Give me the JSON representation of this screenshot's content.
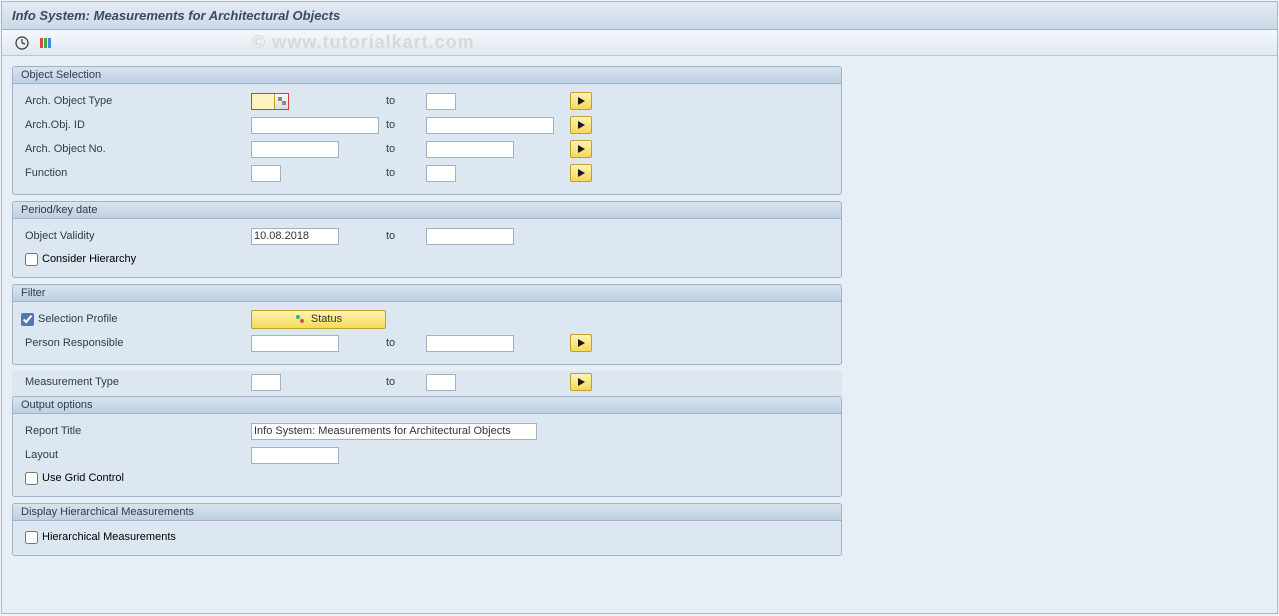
{
  "title": "Info System: Measurements for Architectural Objects",
  "watermark": "© www.tutorialkart.com",
  "groups": {
    "object_selection": {
      "title": "Object Selection",
      "rows": {
        "arch_object_type": {
          "label": "Arch. Object Type",
          "from": "",
          "to_label": "to",
          "to": ""
        },
        "arch_obj_id": {
          "label": "Arch.Obj. ID",
          "from": "",
          "to_label": "to",
          "to": ""
        },
        "arch_object_no": {
          "label": "Arch. Object No.",
          "from": "",
          "to_label": "to",
          "to": ""
        },
        "function": {
          "label": "Function",
          "from": "",
          "to_label": "to",
          "to": ""
        }
      }
    },
    "period": {
      "title": "Period/key date",
      "object_validity": {
        "label": "Object Validity",
        "from": "10.08.2018",
        "to_label": "to",
        "to": ""
      },
      "consider_hierarchy": {
        "label": "Consider Hierarchy",
        "checked": false
      }
    },
    "filter": {
      "title": "Filter",
      "selection_profile": {
        "label": "Selection Profile",
        "checked": true,
        "button": "Status"
      },
      "person_responsible": {
        "label": "Person Responsible",
        "from": "",
        "to_label": "to",
        "to": ""
      }
    },
    "measurement_type": {
      "label": "Measurement Type",
      "from": "",
      "to_label": "to",
      "to": ""
    },
    "output_options": {
      "title": "Output options",
      "report_title": {
        "label": "Report Title",
        "value": "Info System: Measurements for Architectural Objects"
      },
      "layout": {
        "label": "Layout",
        "value": ""
      },
      "use_grid": {
        "label": "Use Grid Control",
        "checked": false
      }
    },
    "display_hier": {
      "title": "Display Hierarchical Measurements",
      "hierarchical": {
        "label": "Hierarchical Measurements",
        "checked": false
      }
    }
  }
}
